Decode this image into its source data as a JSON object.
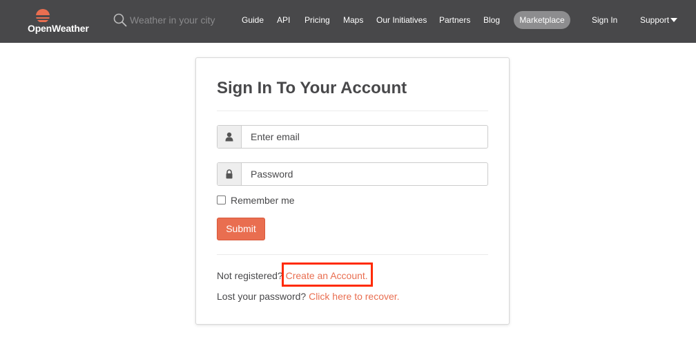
{
  "brand": {
    "name": "OpenWeather",
    "accent": "#e96e50",
    "nav_bg": "#48484a"
  },
  "search": {
    "placeholder": "Weather in your city"
  },
  "nav": {
    "guide": "Guide",
    "api": "API",
    "pricing": "Pricing",
    "maps": "Maps",
    "initiatives": "Our Initiatives",
    "partners": "Partners",
    "blog": "Blog",
    "marketplace": "Marketplace",
    "sign_in": "Sign In",
    "support": "Support"
  },
  "form": {
    "title": "Sign In To Your Account",
    "email_placeholder": "Enter email",
    "password_placeholder": "Password",
    "remember_label": "Remember me",
    "remember_checked": false,
    "submit_label": "Submit",
    "not_registered_text": "Not registered?",
    "create_account_link": "Create an Account.",
    "lost_password_text": "Lost your password?",
    "recover_link": "Click here to recover.",
    "highlight_color": "#ff2a00"
  },
  "icons": {
    "search": "search-icon",
    "email": "user-icon",
    "password": "lock-icon",
    "support_caret": "caret-down-icon"
  }
}
